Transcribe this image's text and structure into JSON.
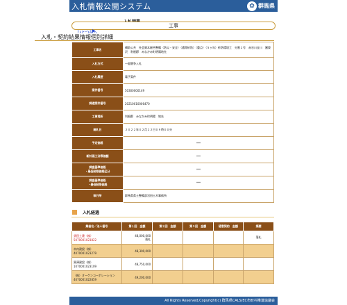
{
  "header": {
    "title": "入札情報公開システム",
    "prefecture": "群馬県",
    "emblem_icon": "prefecture-emblem-icon"
  },
  "category": {
    "label": "入札調書",
    "value": "工事"
  },
  "back_link": "ひとつ前へ",
  "page_title": "入札・契約結果情報個別詳細",
  "details": [
    {
      "label": "工事名",
      "value": "補助公共　社会資本総合整備（防災・安全）（通常砂防）（重点）（５ヶ年）砂防環境工　分割２号　赤谷川支川　圓東沢　利根郡　みなかみ町明陽地先"
    },
    {
      "label": "入札方式",
      "value": "一般競争入札"
    },
    {
      "label": "入札履歴",
      "value": "電子案件"
    },
    {
      "label": "案件番号",
      "value": "50300000149"
    },
    {
      "label": "調達案件番号",
      "value": "20210010006470"
    },
    {
      "label": "工事場所",
      "value": "利根郡　みなかみ町明陽　地先"
    },
    {
      "label": "開札日",
      "value": "２０２２年０２月２２日０９時００分"
    },
    {
      "label": "予定価格",
      "value": "***",
      "center": true
    },
    {
      "label": "新計画工法等価額",
      "value": "***",
      "center": true
    },
    {
      "label": "調査基準価格\n・最低制限価格区分",
      "value": "***",
      "center": true
    },
    {
      "label": "調査基準価格\n・最低制限価格",
      "value": "***",
      "center": true
    },
    {
      "label": "執行所",
      "value": "群馬県県土整備部沼田土木事務所"
    }
  ],
  "results_section_title": "入札経過",
  "results": {
    "columns": [
      "業者名／法人番号",
      "第１回　金額",
      "第２回　金額",
      "第３回　金額",
      "随意契約　金額",
      "摘要"
    ],
    "rows": [
      {
        "name": "須田土建（株）",
        "number": "5070001023822",
        "round1": "48,000,000",
        "round1_note": "落札",
        "round2": "",
        "round3": "",
        "negotiated": "",
        "remarks": "落札",
        "winner": true
      },
      {
        "name": "木内建設（株）",
        "number": "4070001023279",
        "round1": "48,300,000",
        "round1_note": "",
        "round2": "",
        "round3": "",
        "negotiated": "",
        "remarks": "",
        "winner": false
      },
      {
        "name": "黒澤建設（株）",
        "number": "1070001023109",
        "round1": "48,750,000",
        "round1_note": "",
        "round2": "",
        "round3": "",
        "negotiated": "",
        "remarks": "",
        "winner": false
      },
      {
        "name": "（株）オーケンコーポレーション",
        "number": "4070001022859",
        "round1": "49,200,000",
        "round1_note": "",
        "round2": "",
        "round3": "",
        "negotiated": "",
        "remarks": "",
        "winner": false
      }
    ]
  },
  "footer": "All Rights Reserved,Copyright(c) 群馬県CALS/EC市町村推進協議会"
}
